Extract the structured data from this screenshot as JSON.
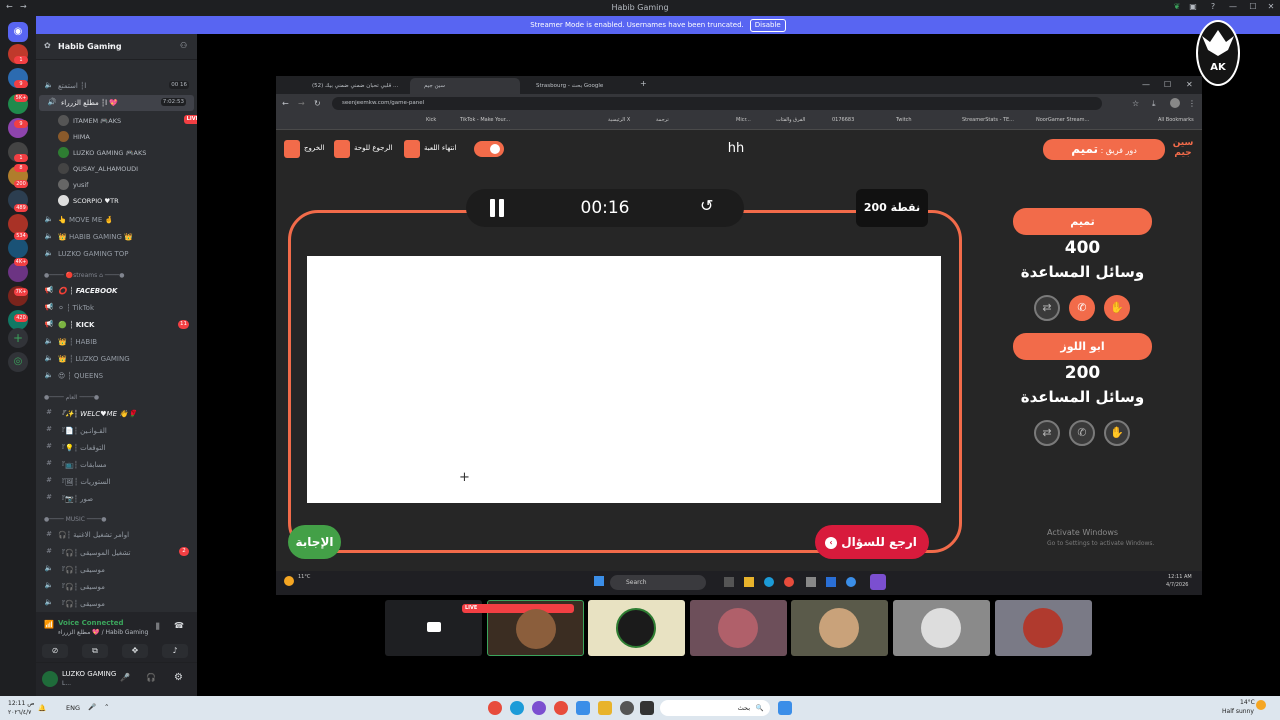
{
  "window": {
    "title": "Habib Gaming",
    "min": "—",
    "max": "☐",
    "close": "✕"
  },
  "banner": {
    "text": "Streamer Mode is enabled. Usernames have been truncated.",
    "disable_label": "Disable"
  },
  "server": {
    "name": "Habib Gaming",
    "chevron": "⌄",
    "invite_icon": "person-add-icon"
  },
  "channels": {
    "voice_top": [
      {
        "label": "ا┆ استمتع",
        "counts": "00 16"
      },
      {
        "label": "ا┆ مطلع الزرراء 💖",
        "counts": "7:02:53",
        "selected": true
      }
    ],
    "users": [
      {
        "name": "ITAMEM 🎮AKS",
        "tag": "LIVE"
      },
      {
        "name": "HIMA",
        "tag": ""
      },
      {
        "name": "LUZKO GAMING 🎮AKS",
        "tag": ""
      },
      {
        "name": "QUSAY_ALHAMOUDI",
        "tag": ""
      },
      {
        "name": "yusif",
        "tag": ""
      },
      {
        "name": "SCORPIO ♥TR",
        "tag": ""
      }
    ],
    "voice_mid": [
      "👆 MOVE ME 🤞",
      "👑 HABIB GAMING 👑",
      "LUZKO GAMING TOP"
    ],
    "cat_streams": "●──── 🔴streams ⌂ ────●",
    "stream_channels": [
      {
        "label": "⭕ ┆ FACEBOOK",
        "badge": ""
      },
      {
        "label": "⚪ ┆ TikTok",
        "badge": ""
      },
      {
        "label": "🟢 ┆ KICK",
        "badge": "11"
      },
      {
        "label": "👑 ┆ HABIB",
        "badge": ""
      },
      {
        "label": "👑 ┆ LUZKO GAMING",
        "badge": ""
      },
      {
        "label": "😍 ┆ QUEENS",
        "badge": ""
      }
    ],
    "cat_welcome": "●──── العام ────●",
    "text_channels": [
      "『✨┆ WELC♥ME 👋🌹",
      "『📄┆ القـوانـين",
      "『💡┆ التوقعات",
      "『📺┆ مسابقات",
      "『🖼┆ الستوريات",
      "『📷┆ صور"
    ],
    "cat_music": "●──── MUSIC ────●",
    "music_channels": [
      {
        "label": "🎧┆ اوامر تشغيل الاغنية",
        "badge": ""
      },
      {
        "label": "『🎧┆ تشغيل الموسيقى",
        "badge": "2"
      },
      {
        "label": "『🎧┆ موسيقى",
        "badge": ""
      },
      {
        "label": "『🎧┆ موسيقى",
        "badge": ""
      },
      {
        "label": "『🎧┆ موسيقى",
        "badge": ""
      }
    ]
  },
  "voice_panel": {
    "status": "Voice Connected",
    "channel": "مطلع الزرراء 💖 / Habib Gaming"
  },
  "user_panel": {
    "name": "LUZKO GAMING",
    "sub": "L..."
  },
  "rail_badges": [
    "1",
    "9",
    "5K+",
    "9",
    "1",
    "8",
    "200",
    "489",
    "534",
    "4K+",
    "7K+",
    "420"
  ],
  "browser": {
    "tabs": [
      {
        "label": "(52) قلبي تحبان ضمني ضمني بيك ...",
        "active": false
      },
      {
        "label": "سين جيم",
        "active": true
      },
      {
        "label": "Strasbourg - بحث Google",
        "active": false
      }
    ],
    "url": "seenjeemkw.com/game-panel",
    "bookmarks": [
      "Kick",
      "TikTok - Make Your...",
      "الرئيسية X",
      "ترجمة",
      "Micr...",
      "الفرق والفئات",
      "0176683",
      "Twitch",
      "StreamerStats - TE...",
      "NoorGamer Stream...",
      "All Bookmarks"
    ]
  },
  "game": {
    "exit": "الخروج",
    "board": "الرجوع للوحة",
    "end": "انتهاء اللعبة",
    "center": "hh",
    "turn_label": "دور فريق :",
    "turn_team": "تميم",
    "timer": "00:16",
    "points": "200 نقطة",
    "answer": "الإجابة",
    "back": "ارجع للسؤال",
    "teams": [
      {
        "name": "تميم",
        "score": "400",
        "aids_label": "وسائل المساعدة",
        "aids_active": [
          false,
          true,
          true
        ]
      },
      {
        "name": "ابو اللوز",
        "score": "200",
        "aids_label": "وسائل المساعدة",
        "aids_active": [
          false,
          false,
          false
        ]
      }
    ],
    "activate1": "Activate Windows",
    "activate2": "Go to Settings to activate Windows.",
    "inner_search": "Search",
    "inner_time": "12:11 AM",
    "inner_date": "4/7/2026",
    "inner_temp": "11°C"
  },
  "stream_tiles": {
    "live": "LIVE",
    "count": 7
  },
  "taskbar": {
    "search": "بحث",
    "time": "12:11 ص",
    "date": "٢٠٢٦/٤/٧",
    "lang": "ENG",
    "temp": "14°C",
    "weather": "Half sunny"
  }
}
